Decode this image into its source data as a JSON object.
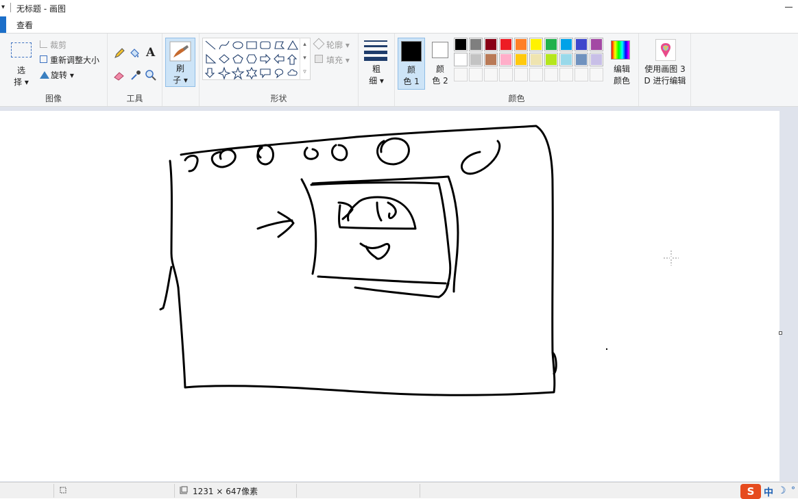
{
  "window": {
    "title": "无标题 - 画图",
    "quick_access": "▾"
  },
  "tabs": {
    "view": "查看"
  },
  "ribbon": {
    "image": {
      "select_label_1": "选",
      "select_label_2": "择",
      "crop": "裁剪",
      "resize": "重新调整大小",
      "rotate": "旋转",
      "group_label": "图像"
    },
    "tools": {
      "group_label": "工具"
    },
    "brush": {
      "label_1": "刷",
      "label_2": "子"
    },
    "shapes": {
      "outline": "轮廓",
      "fill": "填充",
      "group_label": "形状"
    },
    "size": {
      "label_1": "粗",
      "label_2": "细"
    },
    "colors": {
      "color1_label_1": "颜",
      "color1_label_2": "色 1",
      "color2_label_1": "颜",
      "color2_label_2": "色 2",
      "edit_label_1": "编辑",
      "edit_label_2": "颜色",
      "group_label": "颜色",
      "color1_value": "#000000",
      "color2_value": "#ffffff",
      "palette_row1": [
        "#000000",
        "#7f7f7f",
        "#880015",
        "#ed1c24",
        "#ff7f27",
        "#fff200",
        "#22b14c",
        "#00a2e8",
        "#3f48cc",
        "#a349a4"
      ],
      "palette_row2": [
        "#ffffff",
        "#c3c3c3",
        "#b97a57",
        "#ffaec9",
        "#ffc90e",
        "#efe4b0",
        "#b5e61d",
        "#99d9ea",
        "#7092be",
        "#c8bfe7"
      ]
    },
    "paint3d": {
      "label_1": "使用画图 3",
      "label_2": "D 进行编辑"
    }
  },
  "status": {
    "canvas_size": "1231 × 647像素"
  },
  "ime": {
    "lang": "中"
  }
}
